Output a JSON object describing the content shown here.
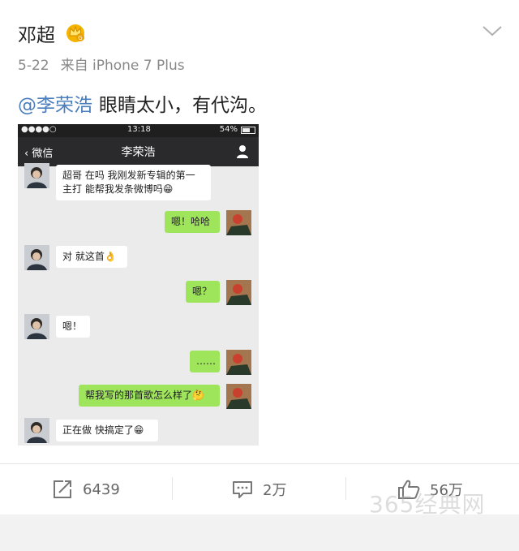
{
  "post": {
    "author": "邓超",
    "date": "5-22",
    "source": "来自 iPhone 7 Plus",
    "mention": "@李荣浩",
    "text": "眼睛太小，有代沟。"
  },
  "embedded": {
    "status": {
      "signal": "●●●●○",
      "time": "13:18",
      "battery": "54%"
    },
    "nav": {
      "back": "微信",
      "title": "李荣浩"
    },
    "messages": [
      {
        "side": "left",
        "text": "超哥 在吗 我刚发新专辑的第一主打 能帮我发条微博吗😁"
      },
      {
        "side": "right",
        "text": "嗯！哈哈"
      },
      {
        "side": "left",
        "text": "对 就这首👌"
      },
      {
        "side": "right",
        "text": "嗯？"
      },
      {
        "side": "left",
        "text": "嗯！"
      },
      {
        "side": "right",
        "text": "……"
      },
      {
        "side": "right",
        "text": "帮我写的那首歌怎么样了🤔"
      },
      {
        "side": "left",
        "text": "正在做 快搞定了😁"
      }
    ]
  },
  "actions": {
    "repost": "6439",
    "comment": "2万",
    "like": "56万"
  },
  "watermark": "365经典网",
  "icons": {
    "badge": "crown-badge-icon",
    "menu": "chevron-down-icon",
    "repost": "repost-icon",
    "comment": "comment-icon",
    "like": "thumbs-up-icon"
  }
}
